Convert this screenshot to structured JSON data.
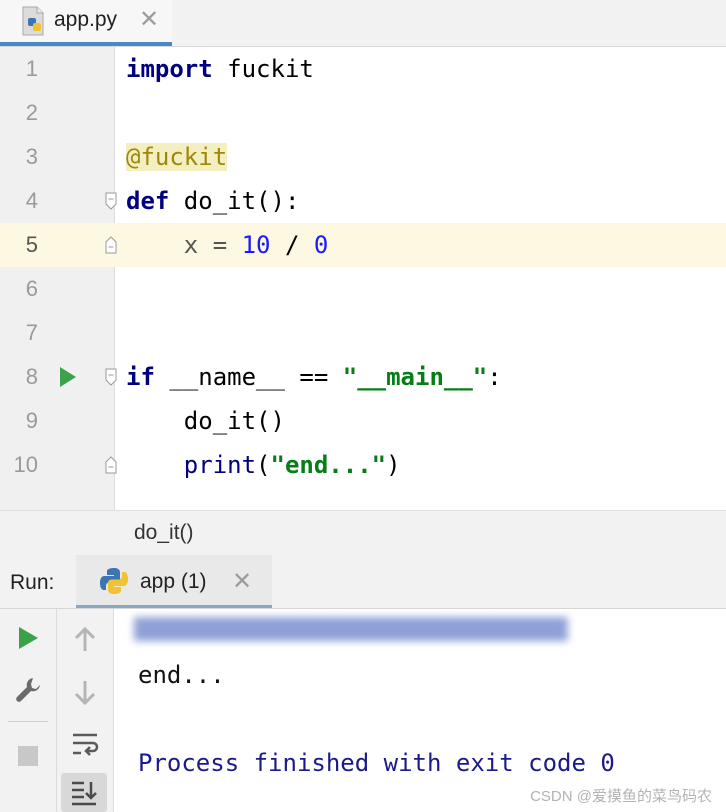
{
  "tab": {
    "filename": "app.py",
    "close": "✕"
  },
  "editor": {
    "line_numbers": [
      "1",
      "2",
      "3",
      "4",
      "5",
      "6",
      "7",
      "8",
      "9",
      "10"
    ],
    "current_line": 5
  },
  "code": {
    "l1_kw": "import",
    "l1_rest": " fuckit",
    "l3_deco": "@fuckit",
    "l4_kw": "def",
    "l4_rest": " do_it():",
    "l5_pre": "    x = ",
    "l5_num1": "10",
    "l5_op": " / ",
    "l5_num2": "0",
    "l8_kw": "if",
    "l8_mid": " __name__ == ",
    "l8_str": "\"__main__\"",
    "l8_end": ":",
    "l9": "    do_it()",
    "l10_pre": "    ",
    "l10_builtin": "print",
    "l10_open": "(",
    "l10_str": "\"end...\"",
    "l10_close": ")"
  },
  "breadcrumb": "do_it()",
  "run": {
    "label": "Run:",
    "tab_label": "app (1)",
    "tab_close": "✕"
  },
  "console": {
    "output_line": "end...",
    "exit_line": "Process finished with exit code 0"
  },
  "watermark": "CSDN @爱摸鱼的菜鸟码农",
  "colors": {
    "accent": "#4a88c7",
    "run_green": "#3aa34a",
    "keyword": "#000080",
    "string": "#067d17",
    "number": "#1a1aff"
  }
}
